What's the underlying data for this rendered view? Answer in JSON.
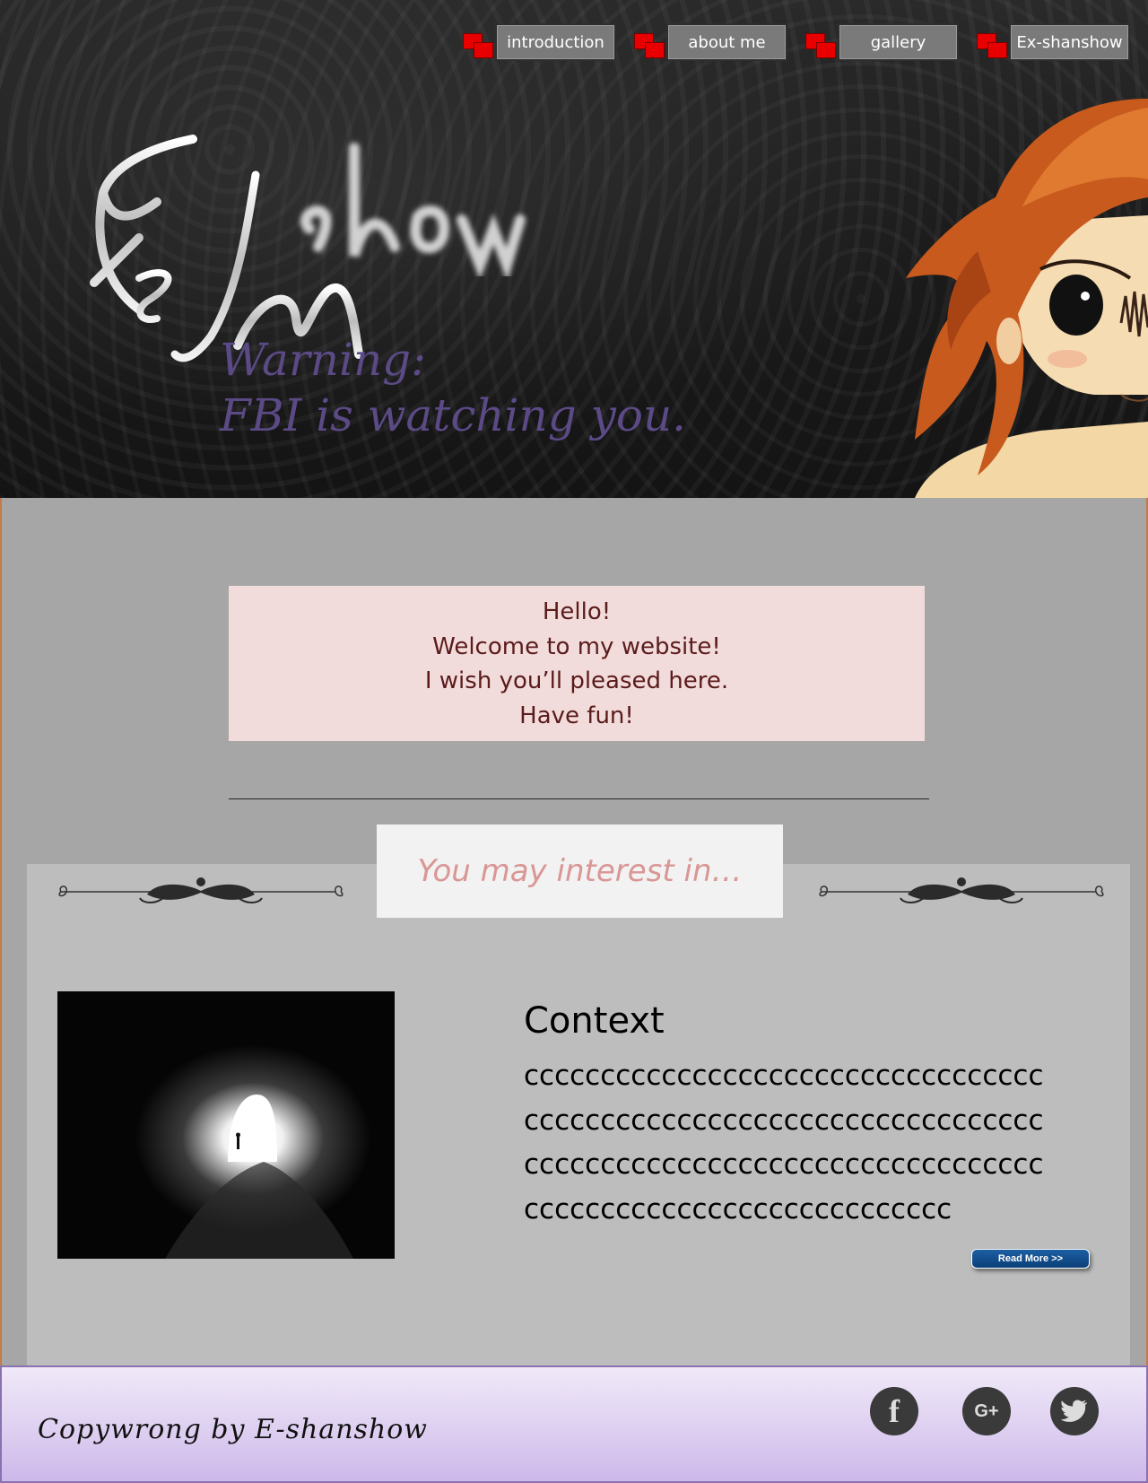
{
  "nav": {
    "items": [
      {
        "label": "introduction"
      },
      {
        "label": "about me"
      },
      {
        "label": "gallery"
      },
      {
        "label": "Ex-shanshow"
      }
    ]
  },
  "header": {
    "warning_line1": "Warning:",
    "warning_line2": "FBI is watching you."
  },
  "welcome": {
    "lines": [
      "Hello!",
      "Welcome to my website!",
      "I wish you’ll pleased here.",
      "Have fun!"
    ]
  },
  "interest": {
    "title": "You may interest in…"
  },
  "context": {
    "title": "Context",
    "lines": [
      "cccccccccccccccccccccccccccccccccc",
      "cccccccccccccccccccccccccccccccccc",
      "cccccccccccccccccccccccccccccccccc",
      "cccccccccccccccccccccccccccc"
    ],
    "read_more": "Read More >>"
  },
  "footer": {
    "copyright": "Copywrong by E-shanshow",
    "social": [
      "facebook-icon",
      "google-plus-icon",
      "twitter-icon"
    ]
  },
  "colors": {
    "nav_button": "#7a7a7a",
    "nav_icon": "#e80000",
    "warning_text": "#5b4a86",
    "welcome_bg": "#f2dcdb",
    "welcome_text": "#5a1b1b",
    "interest_text": "#d99694",
    "main_bg": "#a6a6a6",
    "panel_bg": "#bdbdbd",
    "read_more_bg": "#0b3f78"
  }
}
